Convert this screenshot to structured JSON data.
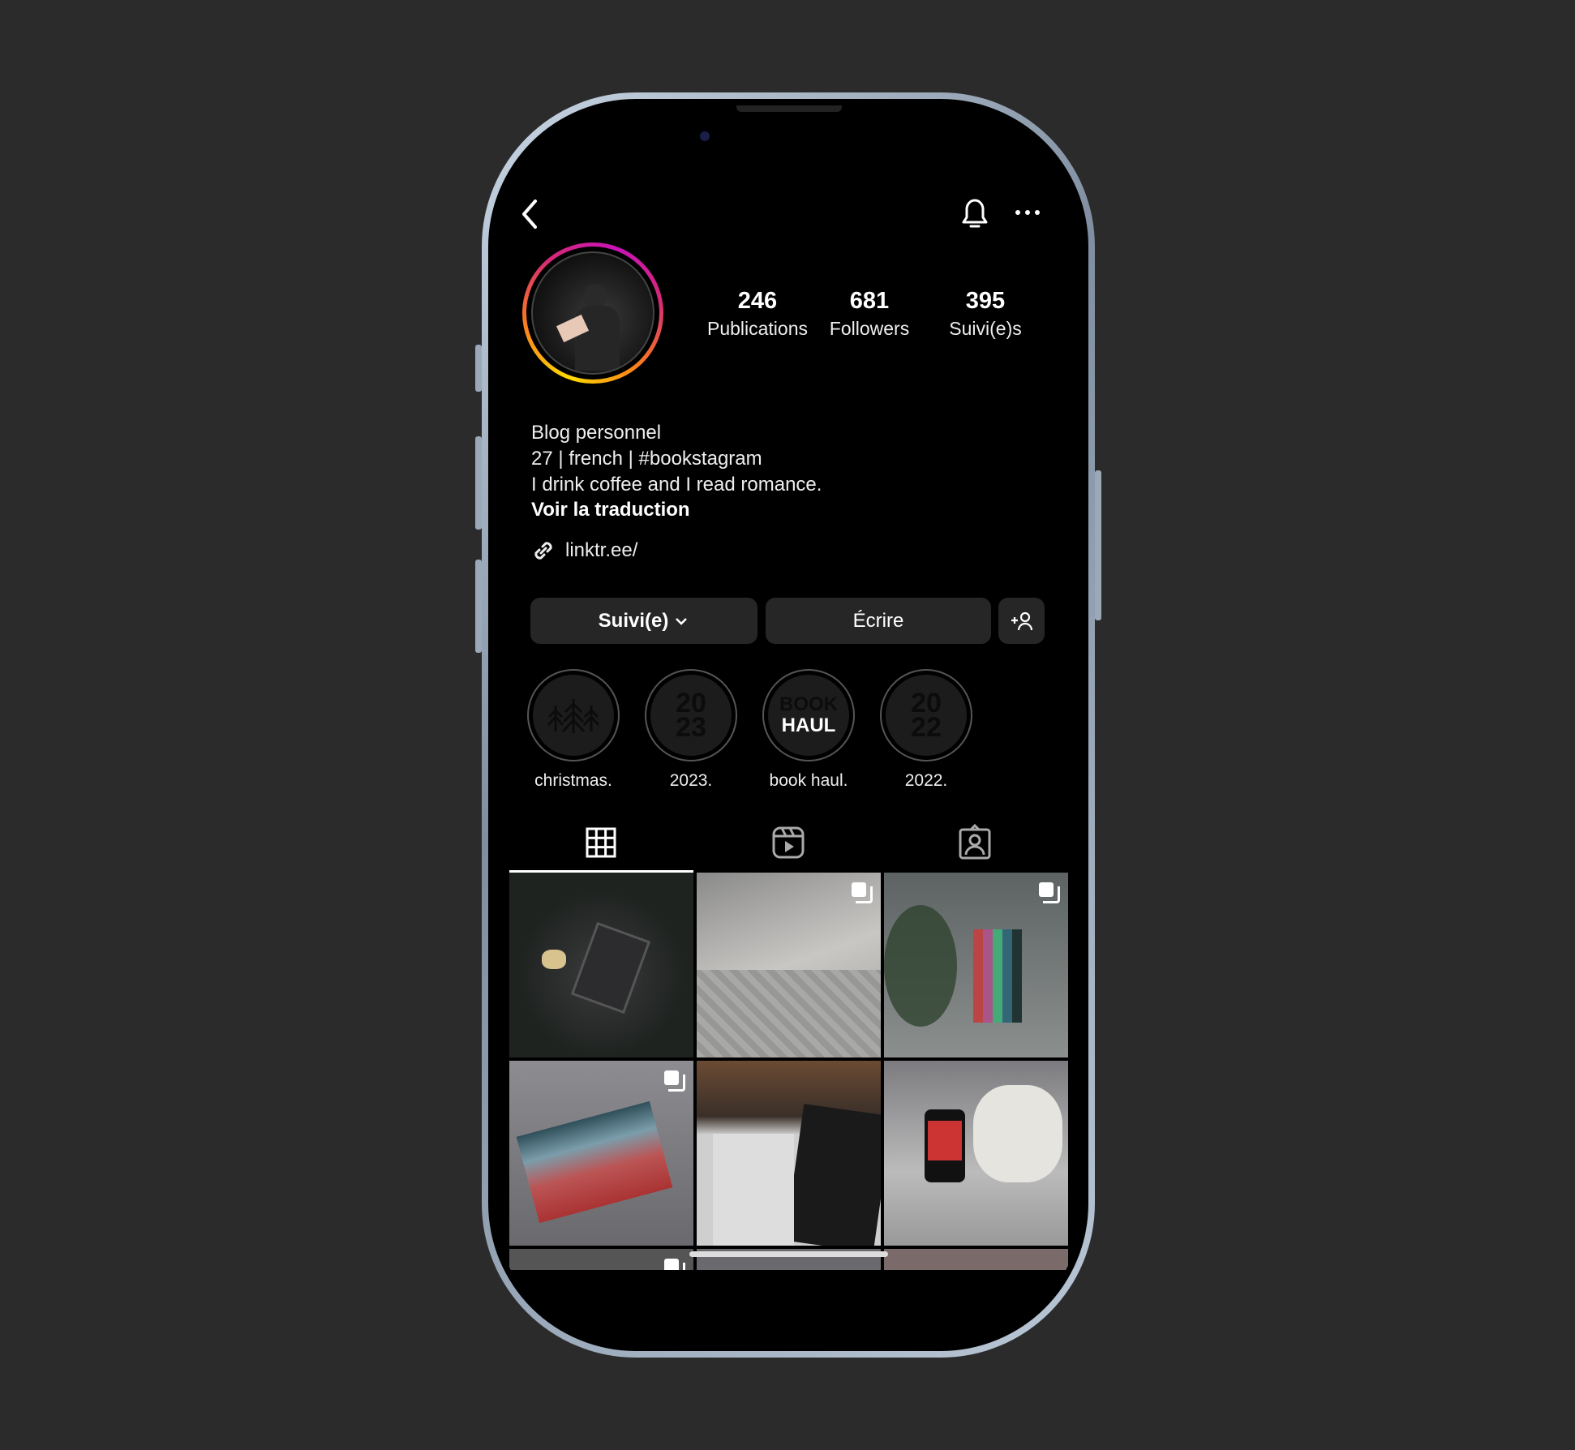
{
  "header": {
    "back_icon": "chevron-left-icon",
    "bell_icon": "bell-icon",
    "more_icon": "more-dots-icon"
  },
  "profile": {
    "stats": [
      {
        "value": "246",
        "label": "Publications"
      },
      {
        "value": "681",
        "label": "Followers"
      },
      {
        "value": "395",
        "label": "Suivi(e)s"
      }
    ],
    "bio": [
      "Blog personnel",
      "27 | french | #bookstagram",
      "I drink coffee and I read romance."
    ],
    "translate": "Voir la traduction",
    "link": "linktr.ee/",
    "story_ring_colors": [
      "#feda00",
      "#fa7e1e",
      "#d62976",
      "#c913b9"
    ]
  },
  "actions": {
    "follow": "Suivi(e)",
    "message": "Écrire",
    "add_icon": "add-person-icon"
  },
  "highlights": [
    {
      "label": "christmas.",
      "cover": ""
    },
    {
      "label": "2023.",
      "cover_top": "20",
      "cover_bottom": "23"
    },
    {
      "label": "book haul.",
      "cover_top": "BOOK",
      "cover_bottom": "HAUL"
    },
    {
      "label": "2022.",
      "cover_top": "20",
      "cover_bottom": "22"
    }
  ],
  "tabs": [
    {
      "icon": "grid-icon",
      "active": true
    },
    {
      "icon": "reels-icon",
      "active": false
    },
    {
      "icon": "tagged-icon",
      "active": false
    }
  ],
  "posts": [
    {
      "multi": false
    },
    {
      "multi": true
    },
    {
      "multi": true
    },
    {
      "multi": true
    },
    {
      "multi": false
    },
    {
      "multi": false
    },
    {
      "multi": true
    },
    {
      "multi": false
    },
    {
      "multi": false
    }
  ]
}
